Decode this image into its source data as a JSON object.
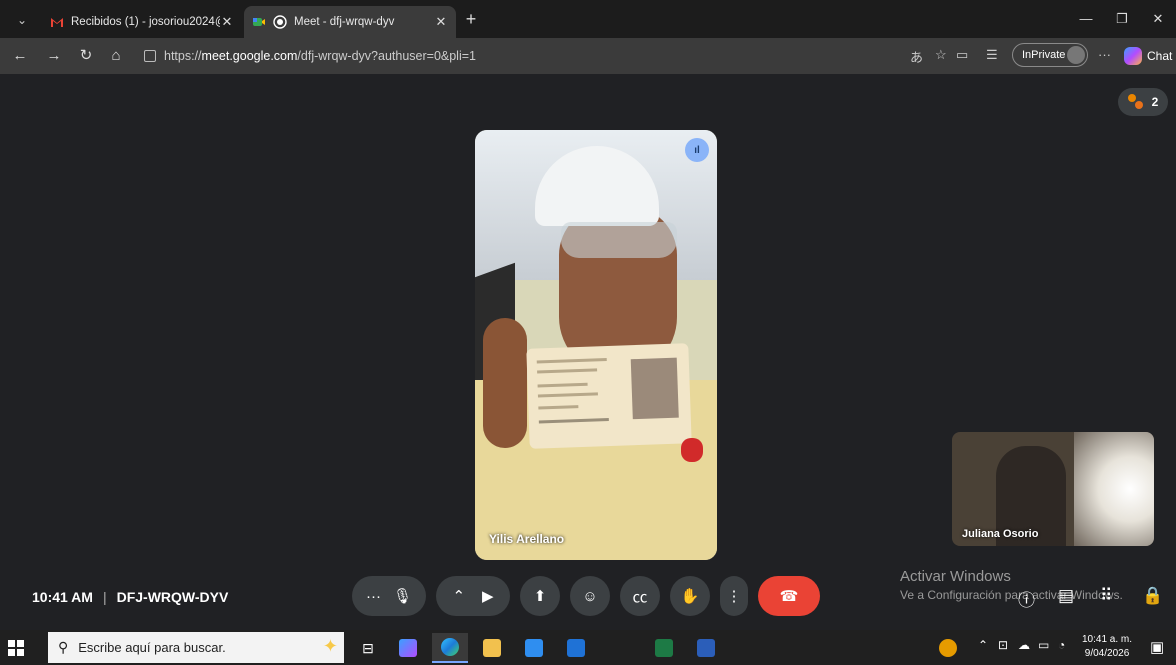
{
  "browser": {
    "tabs": [
      {
        "title": "Recibidos (1) - josoriou2024@gma",
        "favicon": "gmail-icon",
        "active": false
      },
      {
        "title": "Meet - dfj-wrqw-dyv",
        "favicon": "meet-icon",
        "active": true
      }
    ],
    "url_prefix": "https://",
    "url_host": "meet.google.com",
    "url_path": "/dfj-wrqw-dyv?authuser=0&pli=1",
    "inprivate_label": "InPrivate",
    "chat_label": "Chat"
  },
  "meet": {
    "participants_count": "2",
    "main_participant": "Yilis Arellano",
    "self_participant": "Juliana Osorio",
    "time": "10:41 AM",
    "separator": "|",
    "meeting_code": "DFJ-WRQW-DYV",
    "colors": {
      "end_call": "#ea4335",
      "active_speaker": "#8ab4f8"
    }
  },
  "watermark": {
    "title": "Activar Windows",
    "subtitle": "Ve a Configuración para activar Windows."
  },
  "taskbar": {
    "search_placeholder": "Escribe aquí para buscar.",
    "clock_time": "10:41 a. m.",
    "clock_date": "9/04/2026"
  }
}
